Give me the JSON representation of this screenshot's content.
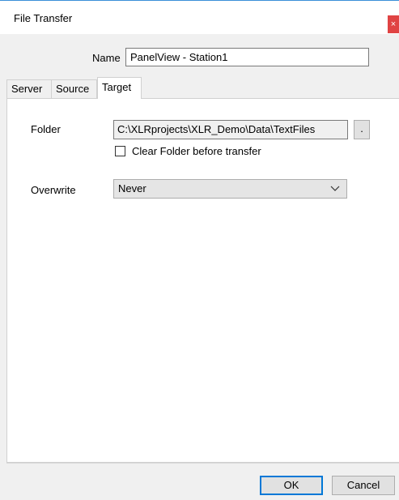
{
  "window": {
    "title": "File Transfer",
    "close_glyph": "×"
  },
  "name": {
    "label": "Name",
    "value": "PanelView - Station1"
  },
  "tabs": [
    {
      "label": "Server",
      "active": false
    },
    {
      "label": "Source",
      "active": false
    },
    {
      "label": "Target",
      "active": true
    }
  ],
  "target": {
    "folder_label": "Folder",
    "folder_value": "C:\\XLRprojects\\XLR_Demo\\Data\\TextFiles",
    "browse_label": ".",
    "clear_folder_label": "Clear Folder before transfer",
    "clear_folder_checked": false,
    "overwrite_label": "Overwrite",
    "overwrite_value": "Never"
  },
  "footer": {
    "ok_label": "OK",
    "cancel_label": "Cancel"
  },
  "colors": {
    "accent": "#0078d7",
    "close": "#e04343"
  }
}
